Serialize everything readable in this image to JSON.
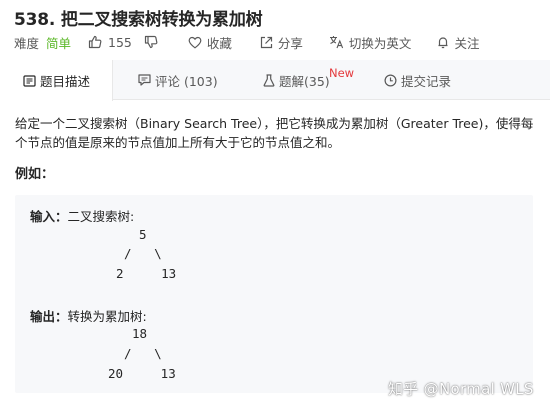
{
  "problem": {
    "title": "538. 把二叉搜索树转换为累加树"
  },
  "meta": {
    "difficulty_label": "难度",
    "difficulty_value": "简单",
    "like_count": "155",
    "collect_label": "收藏",
    "share_label": "分享",
    "lang_label": "切换为英文",
    "follow_label": "关注"
  },
  "tabs": [
    {
      "label": "题目描述"
    },
    {
      "label": "评论 (103)"
    },
    {
      "label": "题解(35)",
      "badge": "New"
    },
    {
      "label": "提交记录"
    }
  ],
  "description": {
    "text": "给定一个二叉搜索树（Binary Search Tree），把它转换成为累加树（Greater Tree)，使得每个节点的值是原来的节点值加上所有大于它的节点值之和。",
    "example_label": "例如："
  },
  "example": {
    "input_label": "输入：",
    "input_text": "二叉搜索树:",
    "input_tree": [
      "5",
      "/   \\",
      "2     13"
    ],
    "output_label": "输出：",
    "output_text": "转换为累加树:",
    "output_tree": [
      "18",
      "/   \\",
      "20     13"
    ]
  },
  "watermark": "知乎 @Normal WLS",
  "colors": {
    "difficulty": "#5ab726",
    "badge": "#e4393c",
    "tab_bar": "#f7f8fa",
    "code_bg": "#f7f8fa"
  }
}
